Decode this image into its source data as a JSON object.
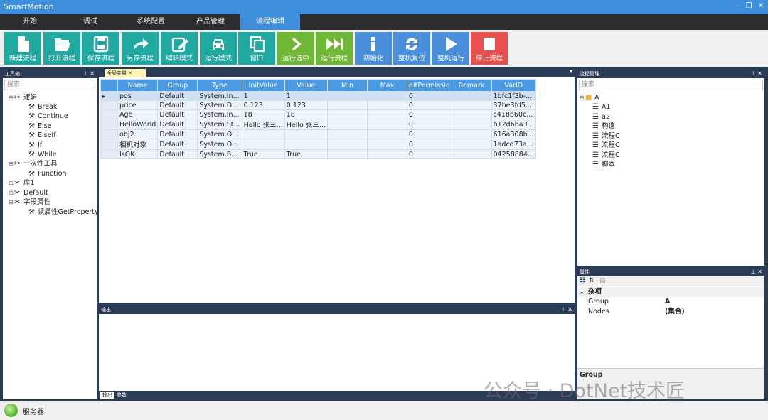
{
  "app": {
    "title": "SmartMotion"
  },
  "menu": {
    "tabs": [
      "开始",
      "调试",
      "系统配置",
      "产品管理",
      "流程编辑"
    ],
    "active_index": 4
  },
  "toolbar": {
    "buttons": [
      {
        "label": "新建流程",
        "icon": "new-file-icon",
        "color": "#1fa9a0"
      },
      {
        "label": "打开流程",
        "icon": "folder-open-icon",
        "color": "#1fa9a0"
      },
      {
        "label": "保存流程",
        "icon": "save-icon",
        "color": "#1fa9a0"
      },
      {
        "label": "另存流程",
        "icon": "share-arrow-icon",
        "color": "#1fa9a0"
      },
      {
        "label": "编辑模式",
        "icon": "edit-icon",
        "color": "#1fa9a0"
      },
      {
        "label": "运行模式",
        "icon": "car-icon",
        "color": "#1fa9a0"
      },
      {
        "label": "窗口",
        "icon": "window-copy-icon",
        "color": "#1fa9a0"
      },
      {
        "label": "运行选中",
        "icon": "chevron-right-icon",
        "color": "#6fb735"
      },
      {
        "label": "运行流程",
        "icon": "fast-forward-icon",
        "color": "#6fb735"
      },
      {
        "label": "初始化",
        "icon": "info-icon",
        "color": "#4a8fdc"
      },
      {
        "label": "整机复位",
        "icon": "refresh-icon",
        "color": "#4a8fdc"
      },
      {
        "label": "整机运行",
        "icon": "play-icon",
        "color": "#4a8fdc"
      },
      {
        "label": "停止流程",
        "icon": "stop-icon",
        "color": "#e94f4f"
      }
    ]
  },
  "toolbox": {
    "title": "工具箱",
    "search_placeholder": "搜索",
    "tree": [
      {
        "label": "逻辑",
        "children": [
          "Break",
          "Continue",
          "Else",
          "ElseIf",
          "If",
          "While"
        ]
      },
      {
        "label": "一次性工具",
        "children": [
          "Function"
        ]
      },
      {
        "label": "库1",
        "children": []
      },
      {
        "label": "Default",
        "children": []
      },
      {
        "label": "字段属性",
        "children": [
          "读属性GetProperty"
        ]
      }
    ]
  },
  "document": {
    "tab_label": "全局变量"
  },
  "vars": {
    "columns": [
      "Name",
      "Group",
      "Type",
      "InitValue",
      "Value",
      "Min",
      "Max",
      "ditPermissio",
      "Remark",
      "VarID"
    ],
    "rows": [
      [
        "pos",
        "Default",
        "System.In...",
        "1",
        "1",
        "",
        "",
        "0",
        "",
        "1bfc1f3b-..."
      ],
      [
        "price",
        "Default",
        "System.D...",
        "0.123",
        "0.123",
        "",
        "",
        "0",
        "",
        "37be3fd5..."
      ],
      [
        "Age",
        "Default",
        "System.In...",
        "18",
        "18",
        "",
        "",
        "0",
        "",
        "c418b60c..."
      ],
      [
        "HelloWorld",
        "Default",
        "System.St...",
        "Hello 张三...",
        "Hello 张三...",
        "",
        "",
        "0",
        "",
        "b12d6ba3..."
      ],
      [
        "obj2",
        "Default",
        "System.O...",
        "",
        "",
        "",
        "",
        "0",
        "",
        "616a308b..."
      ],
      [
        "相机对象",
        "Default",
        "System.O...",
        "",
        "",
        "",
        "",
        "0",
        "",
        "1adcd73a..."
      ],
      [
        "IsOK",
        "Default",
        "System.B...",
        "True",
        "True",
        "",
        "",
        "0",
        "",
        "04258884..."
      ]
    ]
  },
  "output": {
    "title": "输出",
    "tabs": [
      "输出",
      "参数"
    ]
  },
  "flow": {
    "title": "流程管理",
    "search_placeholder": "搜索",
    "root": "A",
    "children": [
      "A1",
      "a2",
      "构造",
      "流程C",
      "流程C",
      "流程C",
      "脚本"
    ]
  },
  "props": {
    "title": "属性",
    "category": "杂项",
    "rows": [
      {
        "name": "Group",
        "value": "A"
      },
      {
        "name": "Nodes",
        "value": "(集合)"
      }
    ],
    "desc_title": "Group"
  },
  "status": {
    "text": "服务器"
  },
  "watermark": "公众号 · DotNet技术匠"
}
